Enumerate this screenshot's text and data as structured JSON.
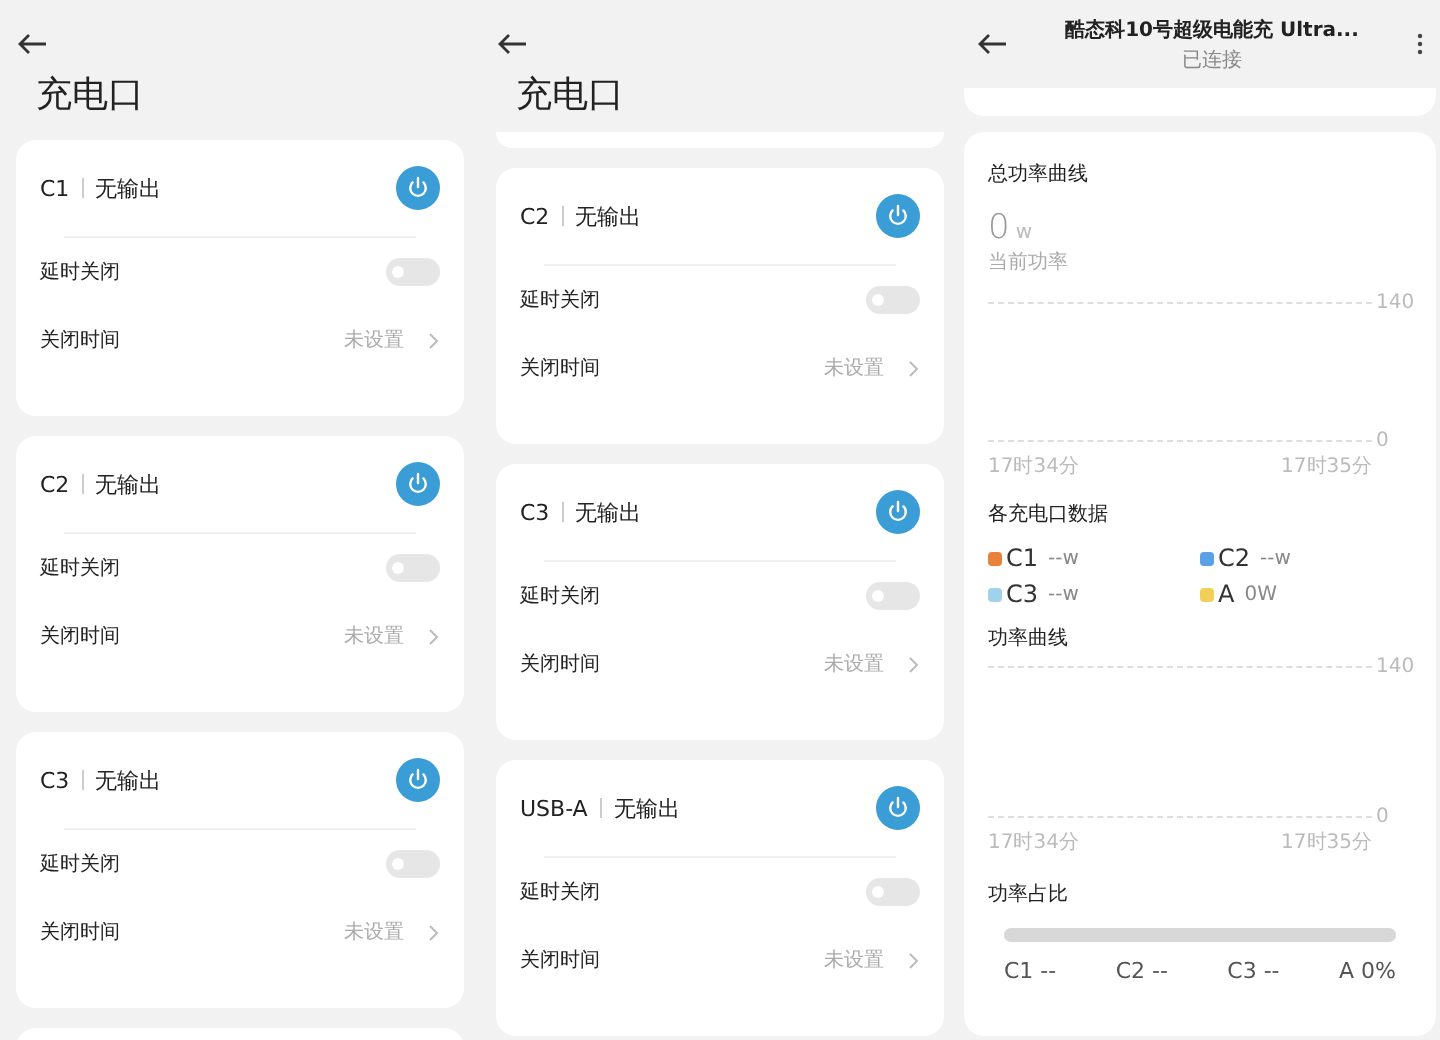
{
  "screen_1": {
    "title": "充电口",
    "ports": [
      {
        "name": "C1",
        "status": "无输出",
        "delay_off": {
          "label": "延时关闭",
          "on": false
        },
        "off_time": {
          "label": "关闭时间",
          "value": "未设置"
        }
      },
      {
        "name": "C2",
        "status": "无输出",
        "delay_off": {
          "label": "延时关闭",
          "on": false
        },
        "off_time": {
          "label": "关闭时间",
          "value": "未设置"
        }
      },
      {
        "name": "C3",
        "status": "无输出",
        "delay_off": {
          "label": "延时关闭",
          "on": false
        },
        "off_time": {
          "label": "关闭时间",
          "value": "未设置"
        }
      }
    ]
  },
  "screen_2": {
    "title": "充电口",
    "ports": [
      {
        "name": "C2",
        "status": "无输出",
        "delay_off": {
          "label": "延时关闭",
          "on": false
        },
        "off_time": {
          "label": "关闭时间",
          "value": "未设置"
        }
      },
      {
        "name": "C3",
        "status": "无输出",
        "delay_off": {
          "label": "延时关闭",
          "on": false
        },
        "off_time": {
          "label": "关闭时间",
          "value": "未设置"
        }
      },
      {
        "name": "USB-A",
        "status": "无输出",
        "delay_off": {
          "label": "延时关闭",
          "on": false
        },
        "off_time": {
          "label": "关闭时间",
          "value": "未设置"
        }
      }
    ]
  },
  "screen_3": {
    "header": {
      "title": "酷态科10号超级电能充 Ultra...",
      "subtitle": "已连接"
    },
    "total_power": {
      "title": "总功率曲线",
      "value": "0",
      "unit": "w",
      "caption": "当前功率",
      "y_labels": [
        "140",
        "0"
      ],
      "x_labels": [
        "17时34分",
        "17时35分"
      ]
    },
    "port_data": {
      "title": "各充电口数据",
      "items": [
        {
          "name": "C1",
          "value": "--w",
          "color": "#e8823a"
        },
        {
          "name": "C2",
          "value": "--w",
          "color": "#5b9fe6"
        },
        {
          "name": "C3",
          "value": "--w",
          "color": "#9fd3ec"
        },
        {
          "name": "A",
          "value": "0W",
          "color": "#f2cf5b"
        }
      ]
    },
    "power_curve": {
      "title": "功率曲线",
      "y_labels": [
        "140",
        "0"
      ],
      "x_labels": [
        "17时34分",
        "17时35分"
      ]
    },
    "power_share": {
      "title": "功率占比",
      "labels": [
        "C1 --",
        "C2 --",
        "C3 --",
        "A 0%"
      ]
    }
  }
}
